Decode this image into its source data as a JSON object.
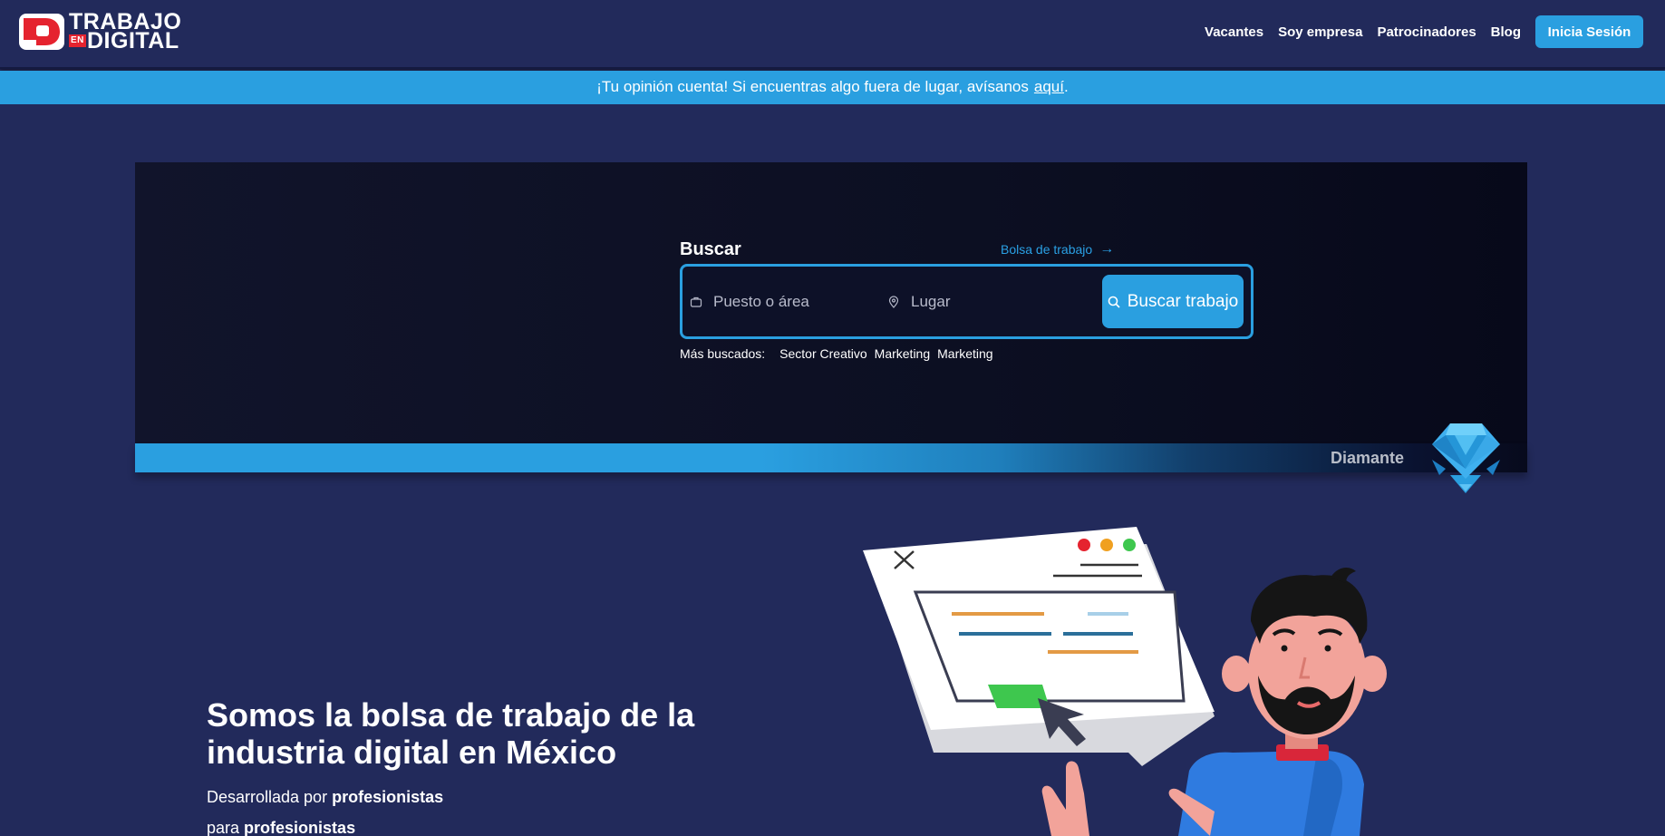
{
  "brand": {
    "line1": "TRABAJO",
    "en": "EN",
    "line2": "DIGITAL"
  },
  "nav": {
    "links": [
      "Vacantes",
      "Soy empresa",
      "Patrocinadores",
      "Blog"
    ],
    "login_label": "Inicia Sesión"
  },
  "banner": {
    "text": "¡Tu opinión cuenta! Si encuentras algo fuera de lugar, avísanos",
    "link": "aquí",
    "suffix": "."
  },
  "search": {
    "title": "Buscar",
    "board_link": "Bolsa de trabajo",
    "position_placeholder": "Puesto o área",
    "location_placeholder": "Lugar",
    "button_label": "Buscar trabajo",
    "popular_label": "Más buscados:",
    "popular_tags": [
      "Sector Creativo",
      "Marketing",
      "Marketing"
    ]
  },
  "tier": {
    "label": "Diamante"
  },
  "hero_text": {
    "headline": "Somos la bolsa de trabajo de la industria digital en México",
    "sub1_prefix": "Desarrollada por",
    "sub1_bold": "profesionistas",
    "sub2_prefix": "para",
    "sub2_bold": "profesionistas"
  },
  "colors": {
    "background": "#222a5b",
    "accent": "#2a9fe0",
    "brand_red": "#e5232f",
    "hero_dark": "#0c0f22"
  }
}
